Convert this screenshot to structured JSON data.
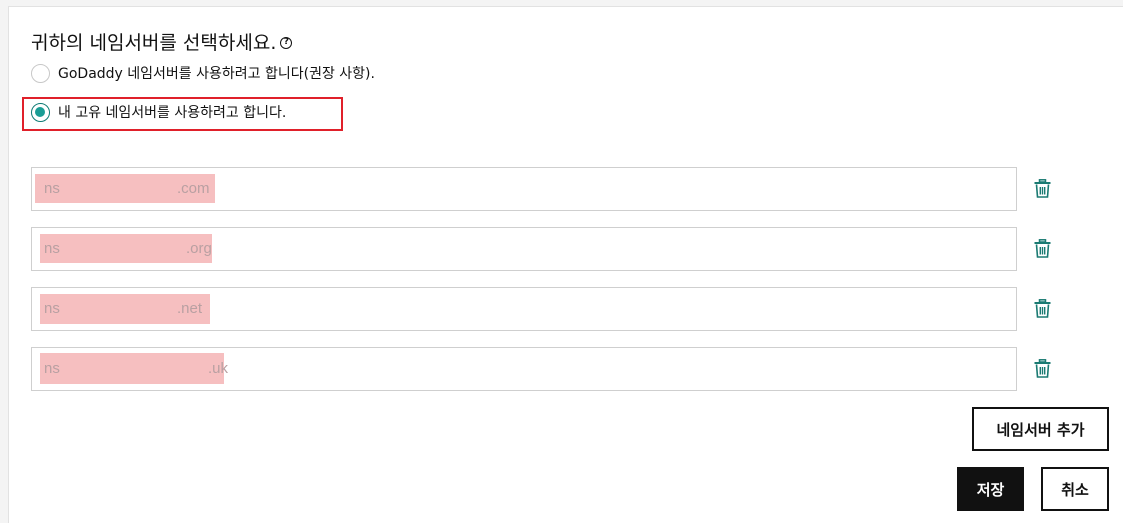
{
  "heading": {
    "title": "귀하의 네임서버를 선택하세요.",
    "help_icon": "question-circle-icon"
  },
  "options": {
    "godaddy_label": "GoDaddy 네임서버를 사용하려고 합니다(권장 사항).",
    "custom_label": "내 고유 네임서버를 사용하려고 합니다.",
    "selected": "custom"
  },
  "nameservers": [
    {
      "prefix": "ns",
      "suffix": ".com"
    },
    {
      "prefix": "ns",
      "suffix": ".org"
    },
    {
      "prefix": "ns",
      "suffix": ".net"
    },
    {
      "prefix": "ns",
      "suffix": ".uk"
    }
  ],
  "actions": {
    "add_label": "네임서버 추가",
    "save_label": "저장",
    "cancel_label": "취소"
  },
  "colors": {
    "accent": "#1a9d95",
    "trash": "#1a7a72",
    "highlight": "#e0202a",
    "redaction": "#f6bfc0"
  }
}
